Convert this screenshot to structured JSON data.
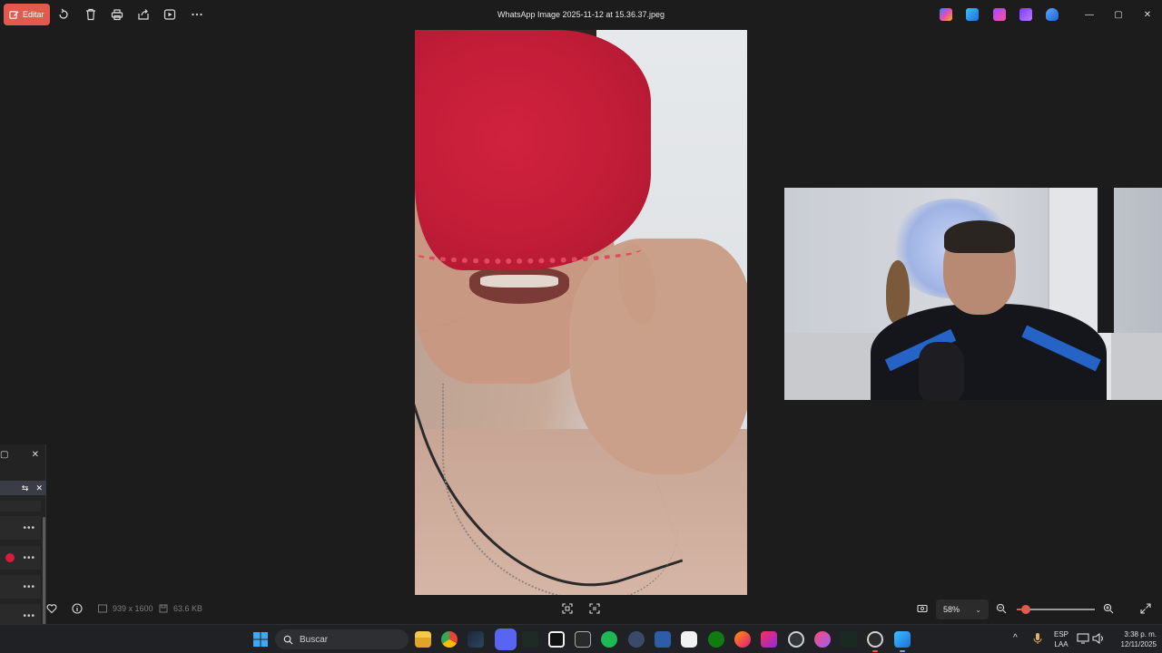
{
  "window": {
    "title": "WhatsApp Image 2025-11-12 at 15.36.37.jpeg",
    "edit_label": "Editar",
    "controls": {
      "minimize": "—",
      "maximize": "▢",
      "close": "✕"
    }
  },
  "toolbar": {
    "icons": [
      "rotate-icon",
      "delete-icon",
      "print-icon",
      "share-icon",
      "slideshow-icon",
      "more-icon"
    ],
    "app_icons": [
      "copilot-icon",
      "photos-app-icon",
      "clipchamp-icon",
      "app-purple-icon",
      "onedrive-icon"
    ]
  },
  "side_panel": {
    "max_glyph": "▢",
    "close_glyph": "✕",
    "header_glyphs": {
      "collapse": "⇆",
      "close": "✕"
    },
    "rows": [
      {
        "menu": "•••",
        "badge": false
      },
      {
        "menu": "•••",
        "badge": true
      },
      {
        "menu": "•••",
        "badge": false
      },
      {
        "menu": "•••",
        "badge": false
      }
    ]
  },
  "info_bar": {
    "dimensions": "939 x 1600",
    "file_size": "63.6 KB",
    "zoom_percent": "58%",
    "zoom_level": 0.58,
    "zoom_slider_fraction": 0.12
  },
  "taskbar": {
    "search_placeholder": "Buscar",
    "language_line1": "ESP",
    "language_line2": "LAA",
    "time": "3:38 p. m.",
    "date": "12/11/2025",
    "tray_chevron": "^",
    "apps": [
      "start-icon",
      "file-explorer-icon",
      "chrome-icon",
      "steam-icon",
      "discord-icon",
      "app-dark-icon",
      "capcut-icon",
      "epic-games-icon",
      "spotify-icon",
      "4k-downloader-icon",
      "app-wavy-icon",
      "gog-icon",
      "xbox-icon",
      "firefox-icon",
      "tiktok-icon",
      "obs-icon",
      "itunes-icon",
      "app-dark2-icon",
      "record-icon",
      "photos-icon"
    ]
  },
  "colors": {
    "accent": "#e25a4d",
    "background": "#1c1c1c",
    "taskbar": "#202124"
  }
}
